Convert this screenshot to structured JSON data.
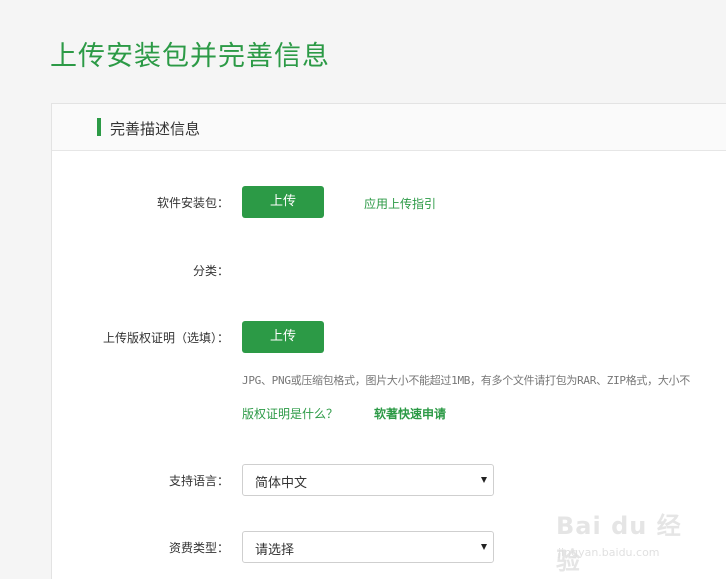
{
  "page": {
    "title": "上传安装包并完善信息"
  },
  "section": {
    "title": "完善描述信息"
  },
  "form": {
    "package_label": "软件安装包：",
    "package_upload_button": "上传",
    "upload_guide_link": "应用上传指引",
    "category_label": "分类：",
    "copyright_label": "上传版权证明（选填）：",
    "copyright_upload_button": "上传",
    "copyright_hint": "JPG、PNG或压缩包格式，图片大小不能超过1MB，有多个文件请打包为RAR、ZIP格式，大小不",
    "what_is_copyright_link": "版权证明是什么？",
    "fast_apply_link": "软著快速申请",
    "language_label": "支持语言：",
    "language_value": "简体中文",
    "fee_label": "资费类型：",
    "fee_value": "请选择"
  },
  "watermark": {
    "text": "Bai du 经验",
    "url": "jingyan.baidu.com"
  },
  "colors": {
    "accent": "#2c9a46"
  }
}
